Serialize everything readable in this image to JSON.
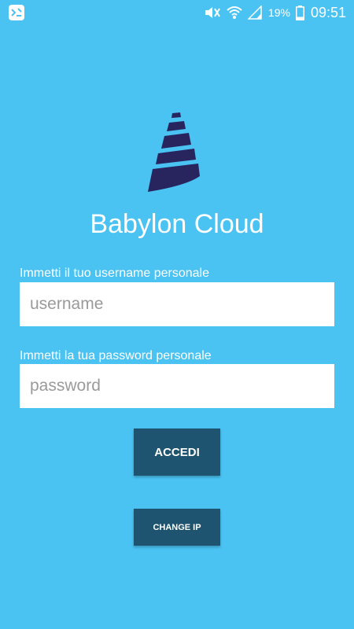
{
  "status_bar": {
    "notification_icon": "app-notification-icon",
    "icons": [
      "mute-icon",
      "wifi-icon",
      "signal-icon"
    ],
    "battery_percent": "19%",
    "time": "09:51"
  },
  "app": {
    "title": "Babylon Cloud",
    "logo_icon": "babylon-tower-logo"
  },
  "login_form": {
    "username_label": "Immetti il tuo username personale",
    "username_placeholder": "username",
    "username_value": "",
    "password_label": "Immetti la tua password personale",
    "password_placeholder": "password",
    "password_value": ""
  },
  "buttons": {
    "login_label": "ACCEDI",
    "change_ip_label": "CHANGE IP"
  },
  "colors": {
    "background": "#4ac2f2",
    "button": "#1f5470",
    "logo": "#27245e",
    "text": "#ffffff"
  }
}
